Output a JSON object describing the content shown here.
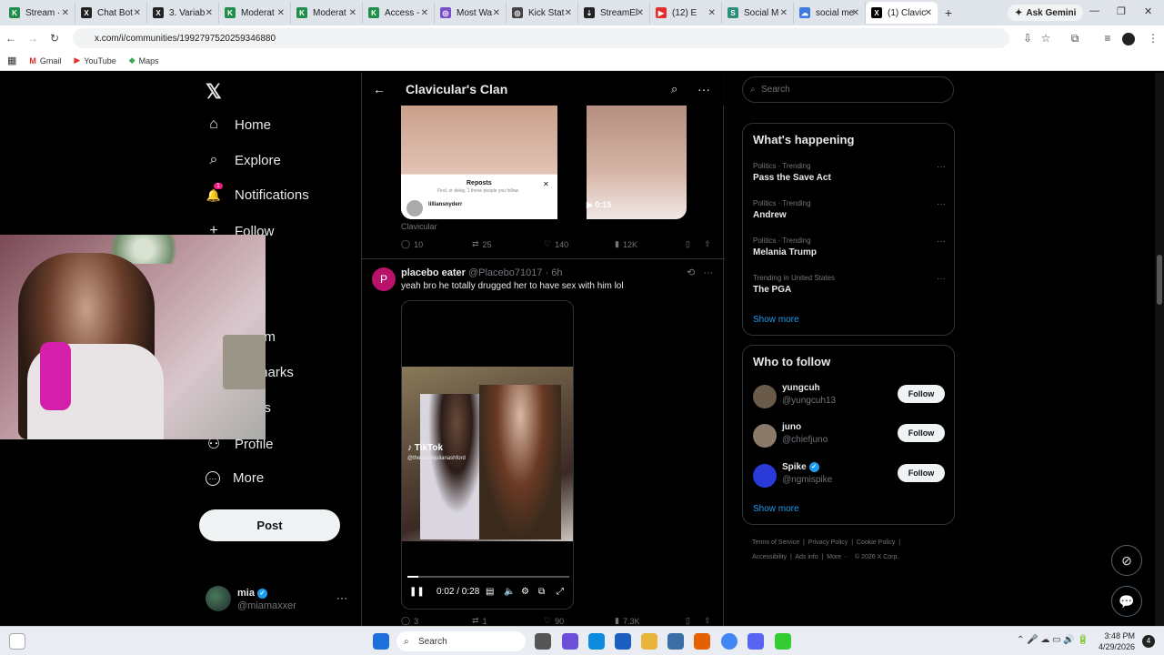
{
  "browser": {
    "tabs": [
      {
        "label": "Stream ·",
        "color": "#1f8e4a",
        "glyph": "K"
      },
      {
        "label": "Chat Bot",
        "color": "#222",
        "glyph": "X"
      },
      {
        "label": "3. Variab",
        "color": "#222",
        "glyph": "X"
      },
      {
        "label": "Moderat",
        "color": "#1f8e4a",
        "glyph": "K"
      },
      {
        "label": "Moderat",
        "color": "#1f8e4a",
        "glyph": "K"
      },
      {
        "label": "Access -",
        "color": "#1f8e4a",
        "glyph": "K"
      },
      {
        "label": "Most Wa",
        "color": "#7a4fc9",
        "glyph": "◎"
      },
      {
        "label": "Kick Stat",
        "color": "#444",
        "glyph": "◎"
      },
      {
        "label": "StreamEl",
        "color": "#222",
        "glyph": "⇣"
      },
      {
        "label": "(12) E",
        "color": "#e52d2d",
        "glyph": "▶"
      },
      {
        "label": "Social M",
        "color": "#2a8f7a",
        "glyph": "S"
      },
      {
        "label": "social me",
        "color": "#3d7be0",
        "glyph": "☁"
      },
      {
        "label": "(1) Clavic",
        "color": "#000",
        "glyph": "X"
      }
    ],
    "new_tab": "+",
    "gemini_label": "Ask Gemini",
    "url": "x.com/i/communities/1992797520259346880",
    "bookmarks": [
      "Gmail",
      "YouTube",
      "Maps"
    ]
  },
  "leftnav": {
    "logo": "𝕏",
    "items": [
      {
        "label": "Home",
        "icon": "⌂"
      },
      {
        "label": "Explore",
        "icon": "⌕"
      },
      {
        "label": "Notifications",
        "icon": "🔔",
        "badge": "1"
      },
      {
        "label": "Follow",
        "icon": "+"
      },
      {
        "label": "um",
        "icon": ""
      },
      {
        "label": "marks",
        "icon": ""
      },
      {
        "label": "es",
        "icon": ""
      },
      {
        "label": "Profile",
        "icon": "⚇"
      },
      {
        "label": "More",
        "icon": "⋯"
      }
    ],
    "post_label": "Post",
    "account": {
      "name": "mia",
      "handle": "@miamaxxer",
      "more": "···"
    }
  },
  "feed": {
    "title": "Clavicular's Clan",
    "back": "←",
    "search": "⌕",
    "more": "···",
    "post1": {
      "repost_card_title": "Reposts",
      "repost_card_sub": "Find, or delay, 1 these people you follow.",
      "repost_card_user": "lilliansnyderr",
      "video_time": "0:15",
      "source": "Clavicular",
      "replies": "10",
      "reposts": "25",
      "likes": "140",
      "views": "12K"
    },
    "post2": {
      "avatar_letter": "P",
      "name": "placebo eater",
      "handle": "@Placebo71017",
      "time": "· 6h",
      "text": "yeah bro he totally drugged her to have sex with him lol",
      "tiktok_label": "TikTok",
      "tiktok_handle": "@theodorejulianashford",
      "video_time": "0:02 / 0:28",
      "progress_fraction": 0.07,
      "replies": "3",
      "reposts": "1",
      "likes": "90",
      "views": "7.3K"
    }
  },
  "rightcol": {
    "search_placeholder": "Search",
    "happening_title": "What's happening",
    "trends": [
      {
        "category": "Politics · Trending",
        "name": "Pass the Save Act"
      },
      {
        "category": "Politics · Trending",
        "name": "Andrew"
      },
      {
        "category": "Politics · Trending",
        "name": "Melania Trump"
      },
      {
        "category": "Trending in United States",
        "name": "The PGA"
      }
    ],
    "show_more": "Show more",
    "follow_title": "Who to follow",
    "who_to_follow": [
      {
        "name": "yungcuh",
        "handle": "@yungcuh13",
        "button": "Follow",
        "color": "#6a5a4a"
      },
      {
        "name": "juno",
        "handle": "@chiefjuno",
        "button": "Follow",
        "color": "#8a7a6a"
      },
      {
        "name": "Spike",
        "handle": "@ngmispike",
        "button": "Follow",
        "color": "#2a3ad9",
        "verified": true
      }
    ],
    "footer": [
      "Terms of Service",
      "Privacy Policy",
      "Cookie Policy",
      "Accessibility",
      "Ads info",
      "More ···",
      "© 2026 X Corp."
    ]
  },
  "taskbar": {
    "search_placeholder": "Search",
    "time": "3:48 PM",
    "date": "4/29/2026",
    "notif_count": "4"
  }
}
